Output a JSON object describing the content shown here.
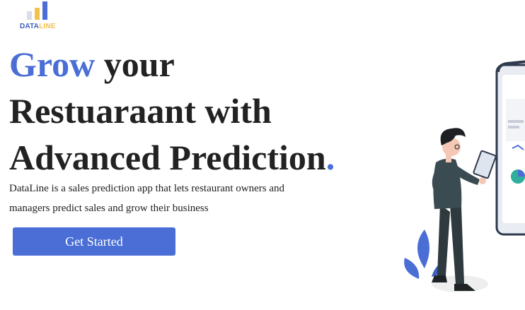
{
  "brand": {
    "logo_part1": "DATA",
    "logo_part2": "LINE"
  },
  "hero": {
    "headline_accent": "Grow",
    "headline_rest_line1": " your",
    "headline_line2": "Restuaraant with",
    "headline_line3": "Advanced Prediction",
    "headline_dot": ".",
    "description": "DataLine is a sales prediction app that lets restaurant owners and managers predict sales and grow their business",
    "cta_label": "Get Started"
  },
  "colors": {
    "accent": "#4a6ed6",
    "logo_yellow": "#f2c14e",
    "text": "#222222"
  },
  "icons": {
    "logo": "bar-chart-logo-icon",
    "illustration": "person-with-clipboard-illustration"
  }
}
